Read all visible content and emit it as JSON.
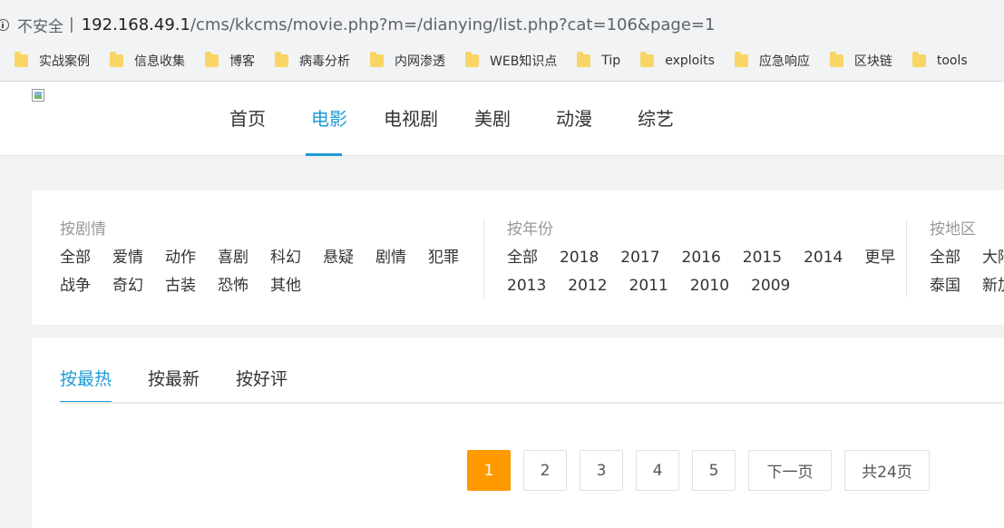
{
  "browser": {
    "insecure_label": "不安全",
    "separator": "|",
    "url_host": "192.168.49.1",
    "url_path": "/cms/kkcms/movie.php?m=/dianying/list.php?cat=106&page=1",
    "bookmarks": [
      "实战案例",
      "信息收集",
      "博客",
      "病毒分析",
      "内网渗透",
      "WEB知识点",
      "Tip",
      "exploits",
      "应急响应",
      "区块链",
      "tools"
    ]
  },
  "header": {
    "nav": [
      {
        "label": "首页"
      },
      {
        "label": "电影",
        "active": true
      },
      {
        "label": "电视剧"
      },
      {
        "label": "美剧"
      },
      {
        "label": "动漫"
      },
      {
        "label": "综艺"
      }
    ]
  },
  "filters": {
    "plot": {
      "title": "按剧情",
      "row1": [
        "全部",
        "爱情",
        "动作",
        "喜剧",
        "科幻",
        "悬疑",
        "剧情",
        "犯罪"
      ],
      "row2": [
        "战争",
        "奇幻",
        "古装",
        "恐怖",
        "其他"
      ]
    },
    "year": {
      "title": "按年份",
      "row1": [
        "全部",
        "2018",
        "2017",
        "2016",
        "2015",
        "2014",
        "更早"
      ],
      "row2": [
        "2013",
        "2012",
        "2011",
        "2010",
        "2009"
      ]
    },
    "region": {
      "title": "按地区",
      "row1": [
        "全部",
        "大陆"
      ],
      "row2": [
        "泰国",
        "新加坡"
      ]
    }
  },
  "sort": {
    "tabs": [
      {
        "label": "按最热",
        "active": true
      },
      {
        "label": "按最新"
      },
      {
        "label": "按好评"
      }
    ]
  },
  "pagination": {
    "pages": [
      "1",
      "2",
      "3",
      "4",
      "5"
    ],
    "current": "1",
    "next_label": "下一页",
    "total_label": "共24页"
  },
  "colors": {
    "accent": "#1f9bd6",
    "current_page": "#ff9900"
  }
}
